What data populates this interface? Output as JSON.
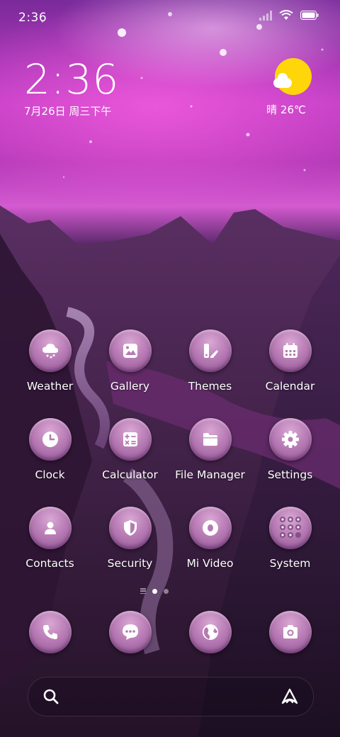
{
  "status_bar": {
    "time": "2:36"
  },
  "clock_widget": {
    "time": "2:36",
    "date": "7月26日 周三下午"
  },
  "weather_widget": {
    "text": "晴 26℃"
  },
  "apps": [
    {
      "label": "Weather",
      "icon": "weather-icon"
    },
    {
      "label": "Gallery",
      "icon": "gallery-icon"
    },
    {
      "label": "Themes",
      "icon": "themes-icon"
    },
    {
      "label": "Calendar",
      "icon": "calendar-icon"
    },
    {
      "label": "Clock",
      "icon": "clock-icon"
    },
    {
      "label": "Calculator",
      "icon": "calculator-icon"
    },
    {
      "label": "File Manager",
      "icon": "folder-icon"
    },
    {
      "label": "Settings",
      "icon": "gear-icon"
    },
    {
      "label": "Contacts",
      "icon": "contact-icon"
    },
    {
      "label": "Security",
      "icon": "shield-icon"
    },
    {
      "label": "Mi Video",
      "icon": "video-icon"
    },
    {
      "label": "System",
      "icon": "app-folder-icon"
    }
  ],
  "dock": [
    {
      "icon": "phone-icon"
    },
    {
      "icon": "messages-icon"
    },
    {
      "icon": "browser-icon"
    },
    {
      "icon": "camera-icon"
    }
  ],
  "page_indicator": {
    "pages": 2,
    "active": 1
  },
  "colors": {
    "sun": "#ffd60a",
    "icon_bubble": "#b97cb6"
  }
}
